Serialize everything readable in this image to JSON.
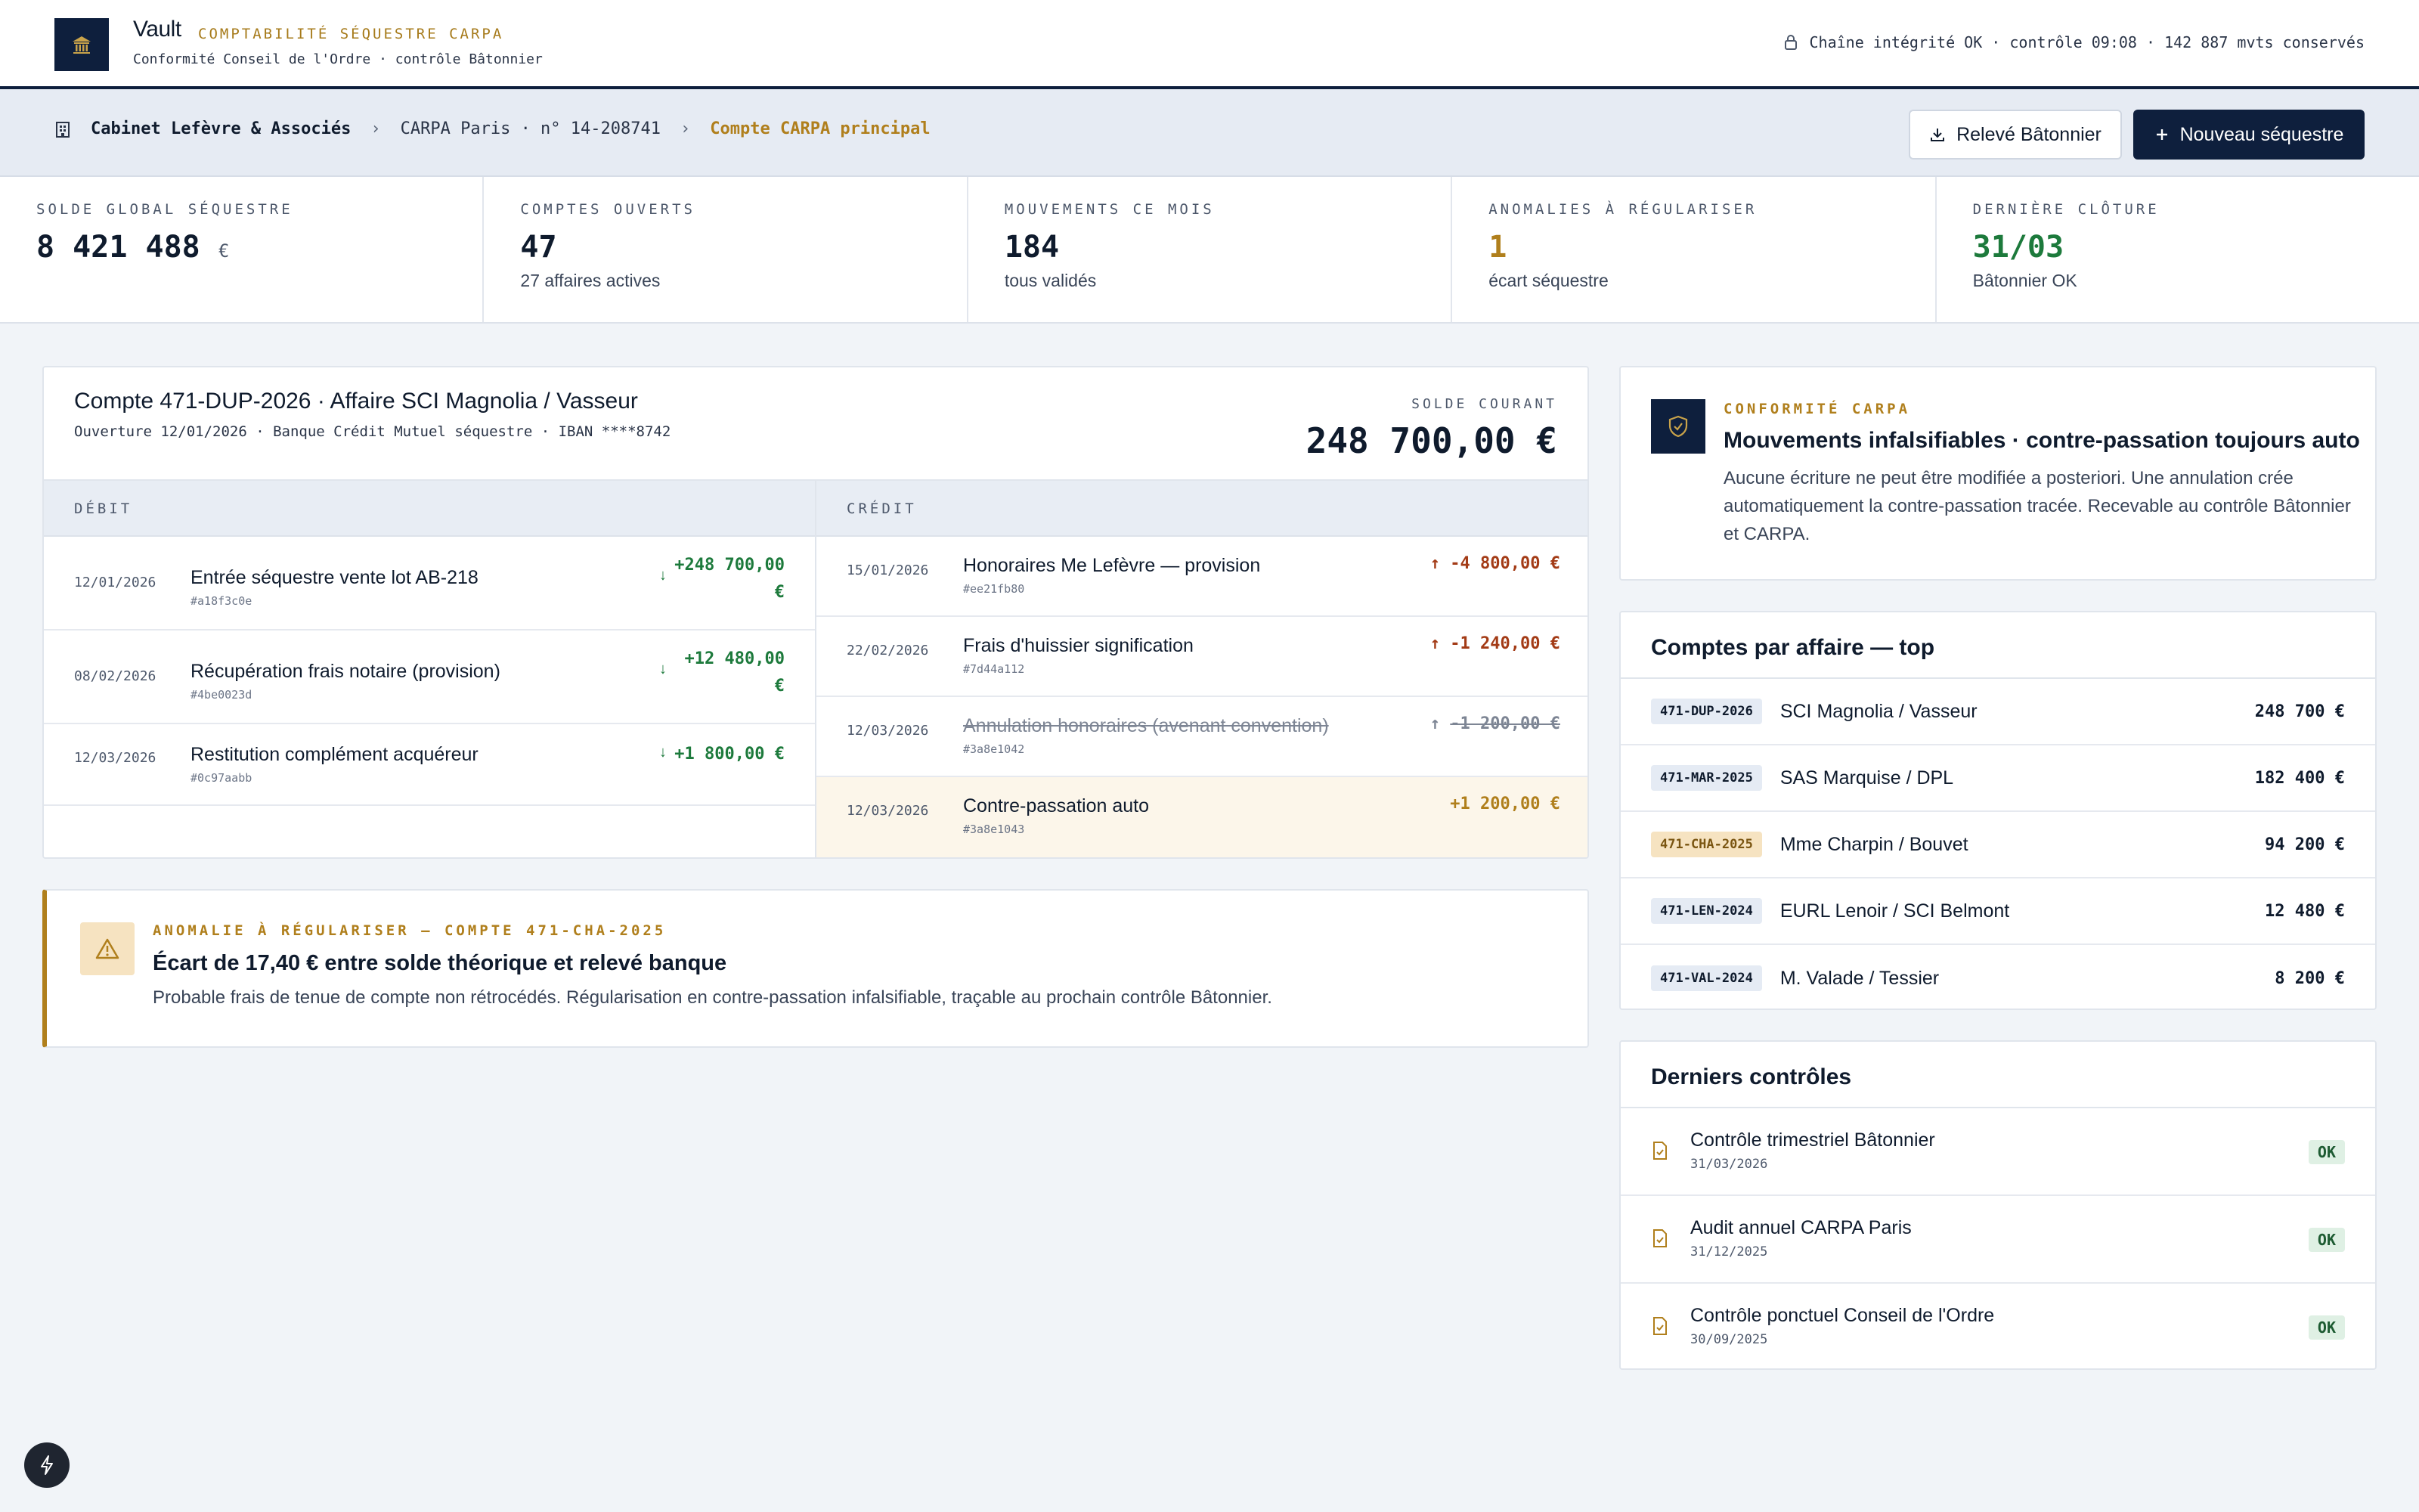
{
  "header": {
    "brand": "Vault",
    "subtitle": "COMPTABILITÉ SÉQUESTRE CARPA",
    "line": "Conformité Conseil de l'Ordre · contrôle Bâtonnier",
    "integrity": "Chaîne intégrité OK · contrôle 09:08 · 142 887 mvts conservés"
  },
  "breadcrumb": {
    "cabinet": "Cabinet Lefèvre & Associés",
    "carpa": "CARPA Paris · n° 14-208741",
    "compte": "Compte CARPA principal"
  },
  "actions": {
    "releve": "Relevé Bâtonnier",
    "nouveau": "Nouveau séquestre"
  },
  "kpis": [
    {
      "label": "SOLDE GLOBAL SÉQUESTRE",
      "value": "8 421 488",
      "unit": "€",
      "note": "",
      "color": "#0f1b2d"
    },
    {
      "label": "COMPTES OUVERTS",
      "value": "47",
      "unit": "",
      "note": "27 affaires actives",
      "color": "#0f1b2d"
    },
    {
      "label": "MOUVEMENTS CE MOIS",
      "value": "184",
      "unit": "",
      "note": "tous validés",
      "color": "#0f1b2d"
    },
    {
      "label": "ANOMALIES À RÉGULARISER",
      "value": "1",
      "unit": "",
      "note": "écart séquestre",
      "color": "#b07f1c"
    },
    {
      "label": "DERNIÈRE CLÔTURE",
      "value": "31/03",
      "unit": "",
      "note": "Bâtonnier OK",
      "color": "#1d7a3c"
    }
  ],
  "account": {
    "title": "Compte 471-DUP-2026 · Affaire SCI Magnolia / Vasseur",
    "sub": "Ouverture 12/01/2026 · Banque Crédit Mutuel séquestre · IBAN ****8742",
    "solde_label": "SOLDE COURANT",
    "solde_value": "248 700,00 €",
    "debit_head": "DÉBIT",
    "credit_head": "CRÉDIT",
    "debit": [
      {
        "date": "12/01/2026",
        "label": "Entrée séquestre vente lot AB-218",
        "hash": "#a18f3c0e",
        "amount_l1": "+248 700,00",
        "amount_l2": "€"
      },
      {
        "date": "08/02/2026",
        "label": "Récupération frais notaire (provision)",
        "hash": "#4be0023d",
        "amount_l1": "+12 480,00",
        "amount_l2": "€"
      },
      {
        "date": "12/03/2026",
        "label": "Restitution complément acquéreur",
        "hash": "#0c97aabb",
        "amount_l1": "+1 800,00 €",
        "amount_l2": ""
      }
    ],
    "credit": [
      {
        "date": "15/01/2026",
        "label": "Honoraires Me Lefèvre — provision",
        "hash": "#ee21fb80",
        "amount": "-4 800,00 €"
      },
      {
        "date": "22/02/2026",
        "label": "Frais d'huissier signification",
        "hash": "#7d44a112",
        "amount": "-1 240,00 €"
      },
      {
        "date": "12/03/2026",
        "label": "Annulation honoraires (avenant convention)",
        "hash": "#3a8e1042",
        "amount": "-1 200,00 €"
      },
      {
        "date": "12/03/2026",
        "label": "Contre-passation auto",
        "hash": "#3a8e1043",
        "amount": "+1 200,00 €"
      }
    ]
  },
  "anomaly": {
    "tag": "ANOMALIE À RÉGULARISER — COMPTE 471-CHA-2025",
    "title": "Écart de 17,40 € entre solde théorique et relevé banque",
    "desc": "Probable frais de tenue de compte non rétrocédés. Régularisation en contre-passation infalsifiable, traçable au prochain contrôle Bâtonnier."
  },
  "conformite": {
    "tag": "CONFORMITÉ CARPA",
    "title": "Mouvements infalsifiables · contre-passation toujours auto",
    "desc": "Aucune écriture ne peut être modifiée a posteriori. Une annulation crée automatiquement la contre-passation tracée. Recevable au contrôle Bâtonnier et CARPA."
  },
  "comptes": {
    "title": "Comptes par affaire — top",
    "items": [
      {
        "code": "471-DUP-2026",
        "name": "SCI Magnolia / Vasseur",
        "amount": "248 700 €"
      },
      {
        "code": "471-MAR-2025",
        "name": "SAS Marquise / DPL",
        "amount": "182 400 €"
      },
      {
        "code": "471-CHA-2025",
        "name": "Mme Charpin / Bouvet",
        "amount": "94 200 €"
      },
      {
        "code": "471-LEN-2024",
        "name": "EURL Lenoir / SCI Belmont",
        "amount": "12 480 €"
      },
      {
        "code": "471-VAL-2024",
        "name": "M. Valade / Tessier",
        "amount": "8 200 €"
      }
    ]
  },
  "controles": {
    "title": "Derniers contrôles",
    "items": [
      {
        "name": "Contrôle trimestriel Bâtonnier",
        "date": "31/03/2026",
        "status": "OK"
      },
      {
        "name": "Audit annuel CARPA Paris",
        "date": "31/12/2025",
        "status": "OK"
      },
      {
        "name": "Contrôle ponctuel Conseil de l'Ordre",
        "date": "30/09/2025",
        "status": "OK"
      }
    ]
  },
  "colors": {
    "navy": "#0e1f3d",
    "gold": "#b07f1c",
    "green": "#1d7a3c",
    "red": "#a33b16"
  }
}
